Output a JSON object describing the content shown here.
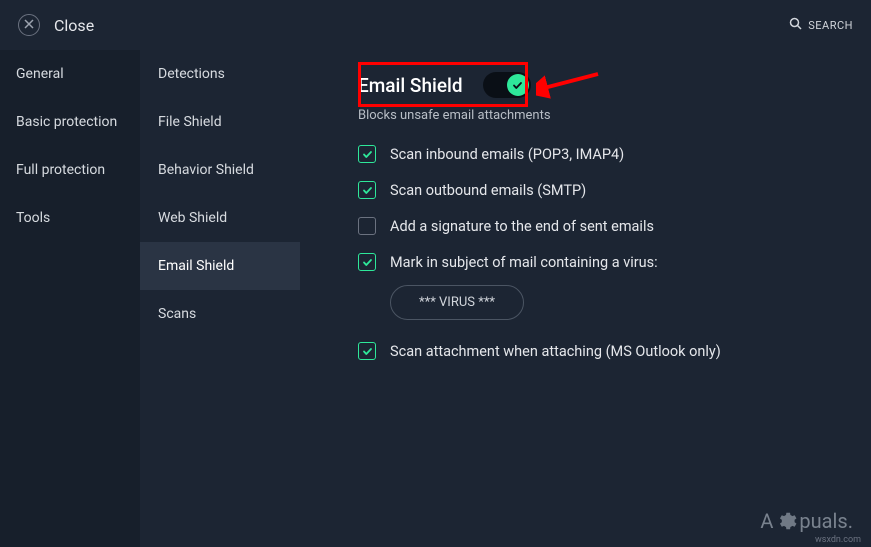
{
  "titlebar": {
    "close_label": "Close",
    "search_label": "SEARCH"
  },
  "sidebar_primary": {
    "items": [
      {
        "label": "General"
      },
      {
        "label": "Basic protection"
      },
      {
        "label": "Full protection"
      },
      {
        "label": "Tools"
      }
    ]
  },
  "sidebar_secondary": {
    "items": [
      {
        "label": "Detections"
      },
      {
        "label": "File Shield"
      },
      {
        "label": "Behavior Shield"
      },
      {
        "label": "Web Shield"
      },
      {
        "label": "Email Shield",
        "active": true
      },
      {
        "label": "Scans"
      }
    ]
  },
  "content": {
    "title": "Email Shield",
    "toggle_on": true,
    "subtitle": "Blocks unsafe email attachments",
    "options": [
      {
        "label": "Scan inbound emails (POP3, IMAP4)",
        "checked": true
      },
      {
        "label": "Scan outbound emails (SMTP)",
        "checked": true
      },
      {
        "label": "Add a signature to the end of sent emails",
        "checked": false
      },
      {
        "label": "Mark in subject of mail containing a virus:",
        "checked": true
      },
      {
        "label": "Scan attachment when attaching (MS Outlook only)",
        "checked": true
      }
    ],
    "virus_subject_text": "*** VIRUS ***"
  },
  "watermark": {
    "prefix": "A",
    "suffix": "puals."
  },
  "domain_mark": "wsxdn.com",
  "colors": {
    "accent": "#2ee89a",
    "highlight": "#ff0000",
    "bg": "#1c2533",
    "sidebar": "#171f2b"
  }
}
